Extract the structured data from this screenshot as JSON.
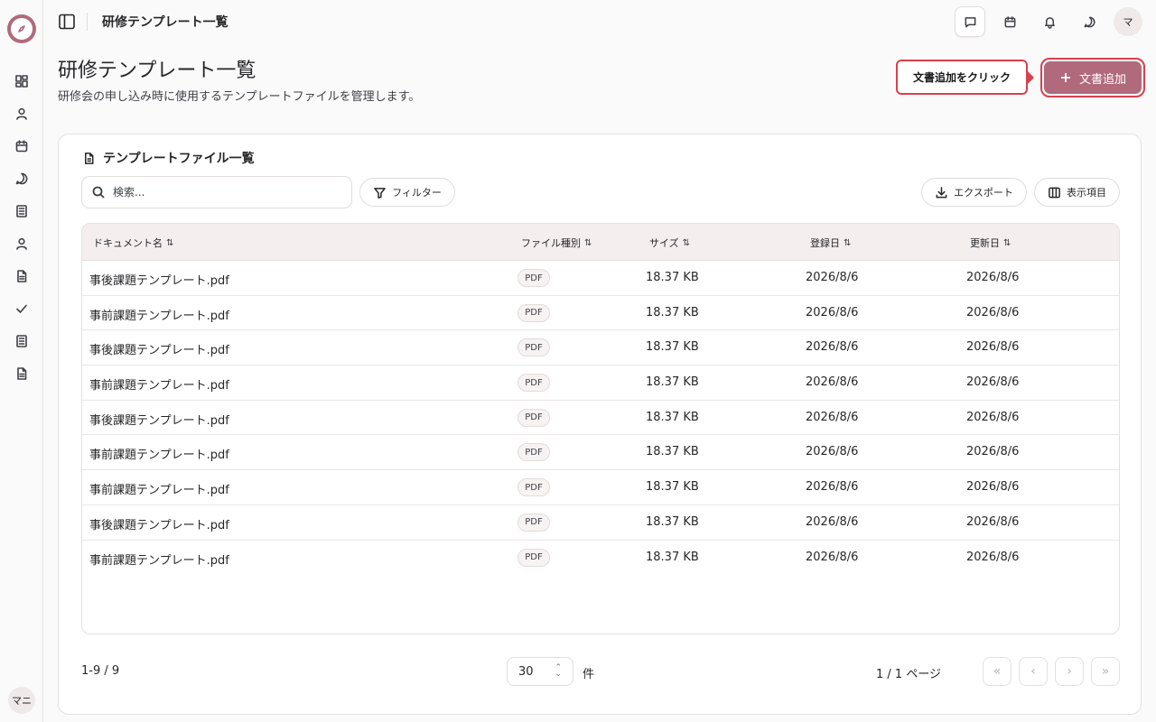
{
  "app": {
    "user_initials_sidebar": "マニ",
    "user_initials_top": "マ"
  },
  "topbar": {
    "title": "研修テンプレート一覧"
  },
  "page": {
    "title": "研修テンプレート一覧",
    "description": "研修会の申し込み時に使用するテンプレートファイルを管理します。",
    "add_button_label": "文書追加",
    "callout_text": "文書追加をクリック"
  },
  "card": {
    "title": "テンプレートファイル一覧",
    "search_placeholder": "検索...",
    "filter_label": "フィルター",
    "export_label": "エクスポート",
    "columns_label": "表示項目"
  },
  "table": {
    "headers": [
      "ドキュメント名",
      "ファイル種別",
      "サイズ",
      "登録日",
      "更新日"
    ],
    "rows": [
      {
        "name": "事後課題テンプレート.pdf",
        "type": "PDF",
        "size": "18.37 KB",
        "created": "2026/8/6",
        "updated": "2026/8/6"
      },
      {
        "name": "事前課題テンプレート.pdf",
        "type": "PDF",
        "size": "18.37 KB",
        "created": "2026/8/6",
        "updated": "2026/8/6"
      },
      {
        "name": "事後課題テンプレート.pdf",
        "type": "PDF",
        "size": "18.37 KB",
        "created": "2026/8/6",
        "updated": "2026/8/6"
      },
      {
        "name": "事前課題テンプレート.pdf",
        "type": "PDF",
        "size": "18.37 KB",
        "created": "2026/8/6",
        "updated": "2026/8/6"
      },
      {
        "name": "事後課題テンプレート.pdf",
        "type": "PDF",
        "size": "18.37 KB",
        "created": "2026/8/6",
        "updated": "2026/8/6"
      },
      {
        "name": "事前課題テンプレート.pdf",
        "type": "PDF",
        "size": "18.37 KB",
        "created": "2026/8/6",
        "updated": "2026/8/6"
      },
      {
        "name": "事前課題テンプレート.pdf",
        "type": "PDF",
        "size": "18.37 KB",
        "created": "2026/8/6",
        "updated": "2026/8/6"
      },
      {
        "name": "事後課題テンプレート.pdf",
        "type": "PDF",
        "size": "18.37 KB",
        "created": "2026/8/6",
        "updated": "2026/8/6"
      },
      {
        "name": "事前課題テンプレート.pdf",
        "type": "PDF",
        "size": "18.37 KB",
        "created": "2026/8/6",
        "updated": "2026/8/6"
      }
    ]
  },
  "pagination": {
    "count_text": "1-9 / 9",
    "page_size": "30",
    "page_size_unit": "件",
    "page_info": "1 / 1 ページ"
  },
  "colors": {
    "brand": "#b06a7c",
    "highlight": "#d9404d",
    "header_bg": "#f5eeef"
  }
}
